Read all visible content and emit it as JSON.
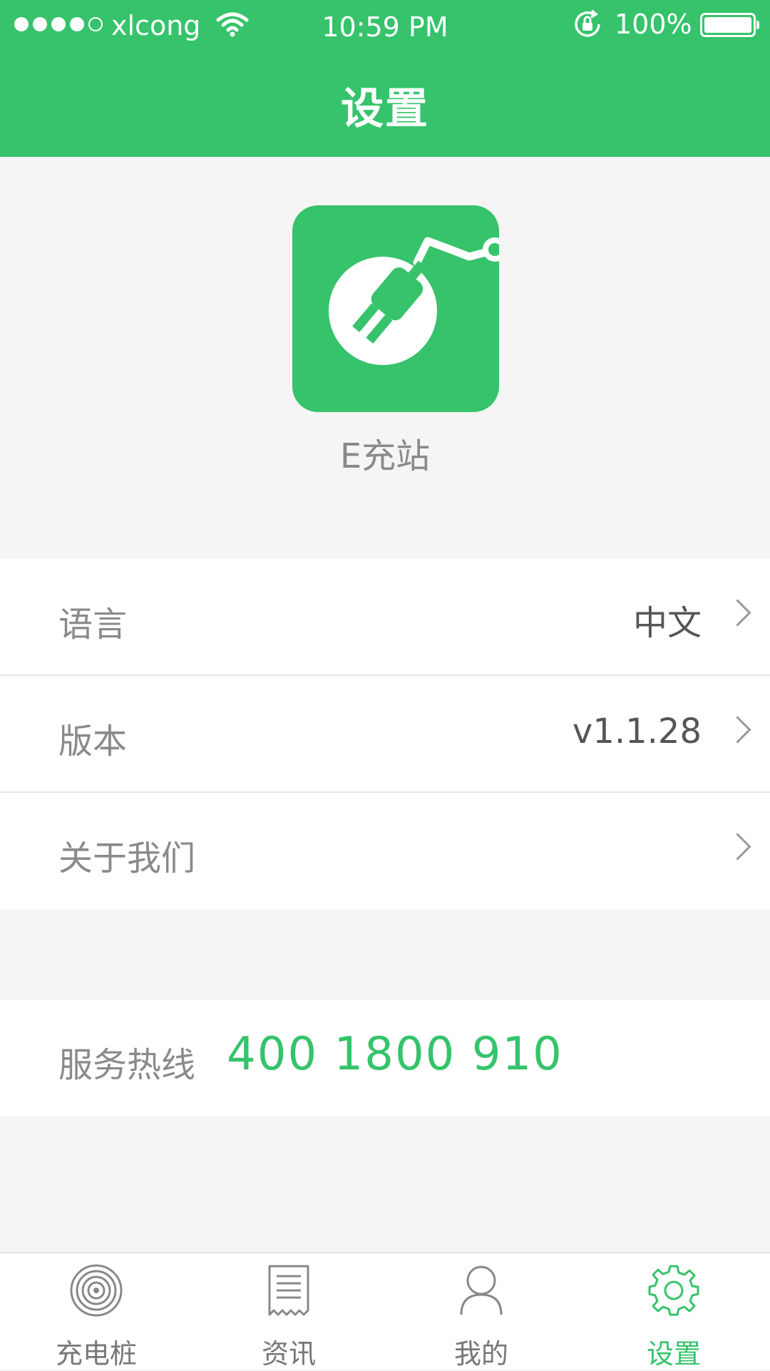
{
  "status_bar": {
    "carrier": "xlcong",
    "time": "10:59 PM",
    "battery": "100%",
    "signal_bars": 4,
    "signal_total": 5
  },
  "header": {
    "title": "设置"
  },
  "app": {
    "name": "E充站",
    "icon": "plug-icon",
    "brand_color": "#36c36b"
  },
  "settings": {
    "language_label": "语言",
    "language_value": "中文",
    "version_label": "版本",
    "version_value": "v1.1.28",
    "about_label": "关于我们"
  },
  "hotline": {
    "label": "服务热线",
    "number": "400 1800 910"
  },
  "tabs": [
    {
      "label": "充电桩",
      "icon": "charging-pile-icon",
      "active": false
    },
    {
      "label": "资讯",
      "icon": "news-icon",
      "active": false
    },
    {
      "label": "我的",
      "icon": "profile-icon",
      "active": false
    },
    {
      "label": "设置",
      "icon": "settings-icon",
      "active": true
    }
  ]
}
